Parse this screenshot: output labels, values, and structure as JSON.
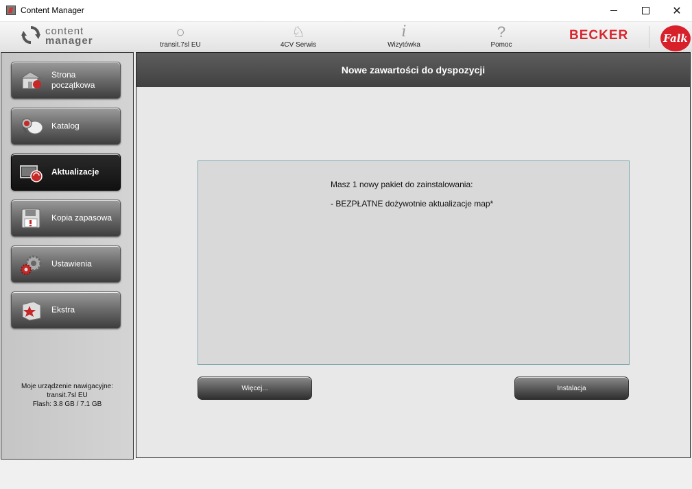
{
  "window": {
    "title": "Content Manager",
    "controls": [
      "minimize",
      "maximize",
      "close"
    ]
  },
  "toolbar": {
    "logo_line1": "content",
    "logo_line2": "manager",
    "items": [
      {
        "label": "transit.7sl EU",
        "icon": "device-icon"
      },
      {
        "label": "4CV Serwis",
        "icon": "service-icon"
      },
      {
        "label": "Wizytówka",
        "icon": "info-icon"
      },
      {
        "label": "Pomoc",
        "icon": "help-icon"
      }
    ],
    "brand_becker": "BECKER",
    "brand_falk": "Falk"
  },
  "sidebar": {
    "items": [
      {
        "label": "Strona początkowa",
        "icon": "home-icon",
        "active": false
      },
      {
        "label": "Katalog",
        "icon": "catalog-icon",
        "active": false
      },
      {
        "label": "Aktualizacje",
        "icon": "update-icon",
        "active": true
      },
      {
        "label": "Kopia zapasowa",
        "icon": "backup-icon",
        "active": false
      },
      {
        "label": "Ustawienia",
        "icon": "settings-icon",
        "active": false
      },
      {
        "label": "Ekstra",
        "icon": "extra-icon",
        "active": false
      }
    ],
    "device_info": {
      "line1": "Moje urządzenie nawigacyjne:",
      "line2": "transit.7sl EU",
      "line3": "Flash: 3.8 GB / 7.1 GB"
    }
  },
  "main": {
    "header": "Nowe zawartości do dyspozycji",
    "message_line1": "Masz 1 nowy pakiet do zainstalowania:",
    "message_line2": "-  BEZPŁATNE dożywotnie aktualizacje map*",
    "more_button": "Więcej...",
    "install_button": "Instalacja"
  },
  "colors": {
    "accent_red": "#d8262e",
    "header_dark": "#4a4a4a",
    "box_border": "#7fa7ae"
  }
}
